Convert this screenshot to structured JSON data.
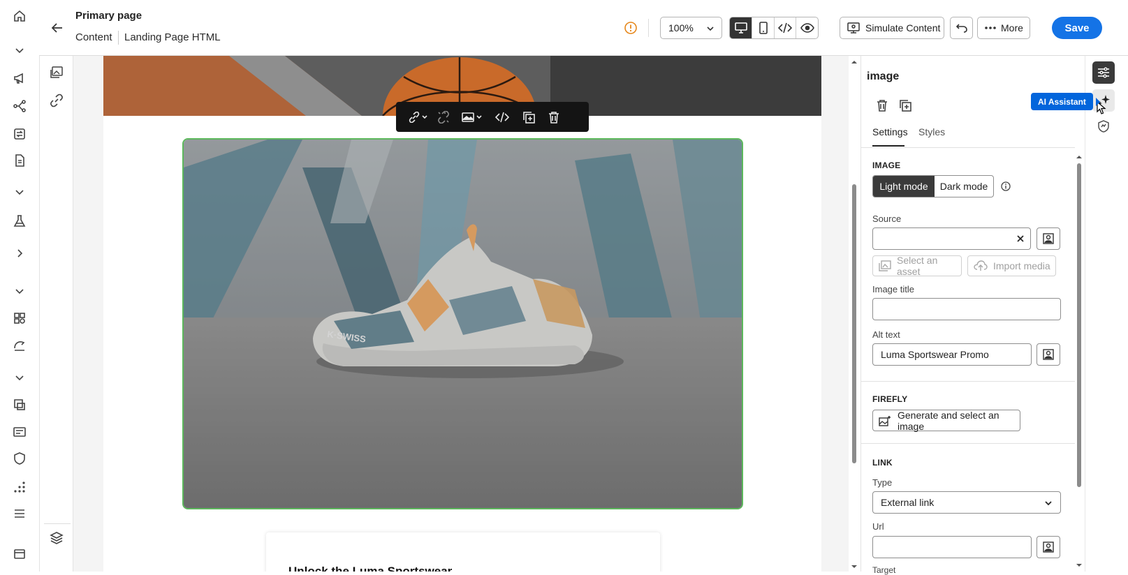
{
  "header": {
    "title": "Primary page",
    "breadcrumb_content": "Content",
    "breadcrumb_page": "Landing Page HTML",
    "zoom": "100%",
    "simulate_label": "Simulate Content",
    "more_label": "More",
    "save_label": "Save"
  },
  "canvas": {
    "card_heading": "Unlock the Luma Sportswear"
  },
  "panel": {
    "title": "image",
    "tabs": [
      "Settings",
      "Styles"
    ],
    "image_section": "IMAGE",
    "light_mode": "Light mode",
    "dark_mode": "Dark mode",
    "source_label": "Source",
    "source_value": "",
    "select_asset": "Select an asset",
    "import_media": "Import media",
    "image_title_label": "Image title",
    "image_title_value": "",
    "alt_text_label": "Alt text",
    "alt_text_value": "Luma Sportswear Promo",
    "firefly_section": "FIREFLY",
    "generate_label": "Generate and select an image",
    "link_section": "LINK",
    "type_label": "Type",
    "type_value": "External link",
    "url_label": "Url",
    "url_value": "",
    "target_label": "Target"
  },
  "tooltip": {
    "ai_assistant": "AI Assistant"
  },
  "colors": {
    "accent": "#1473e6",
    "selection": "#5cb85c",
    "warning": "#e68619",
    "toolbar": "#141414"
  }
}
